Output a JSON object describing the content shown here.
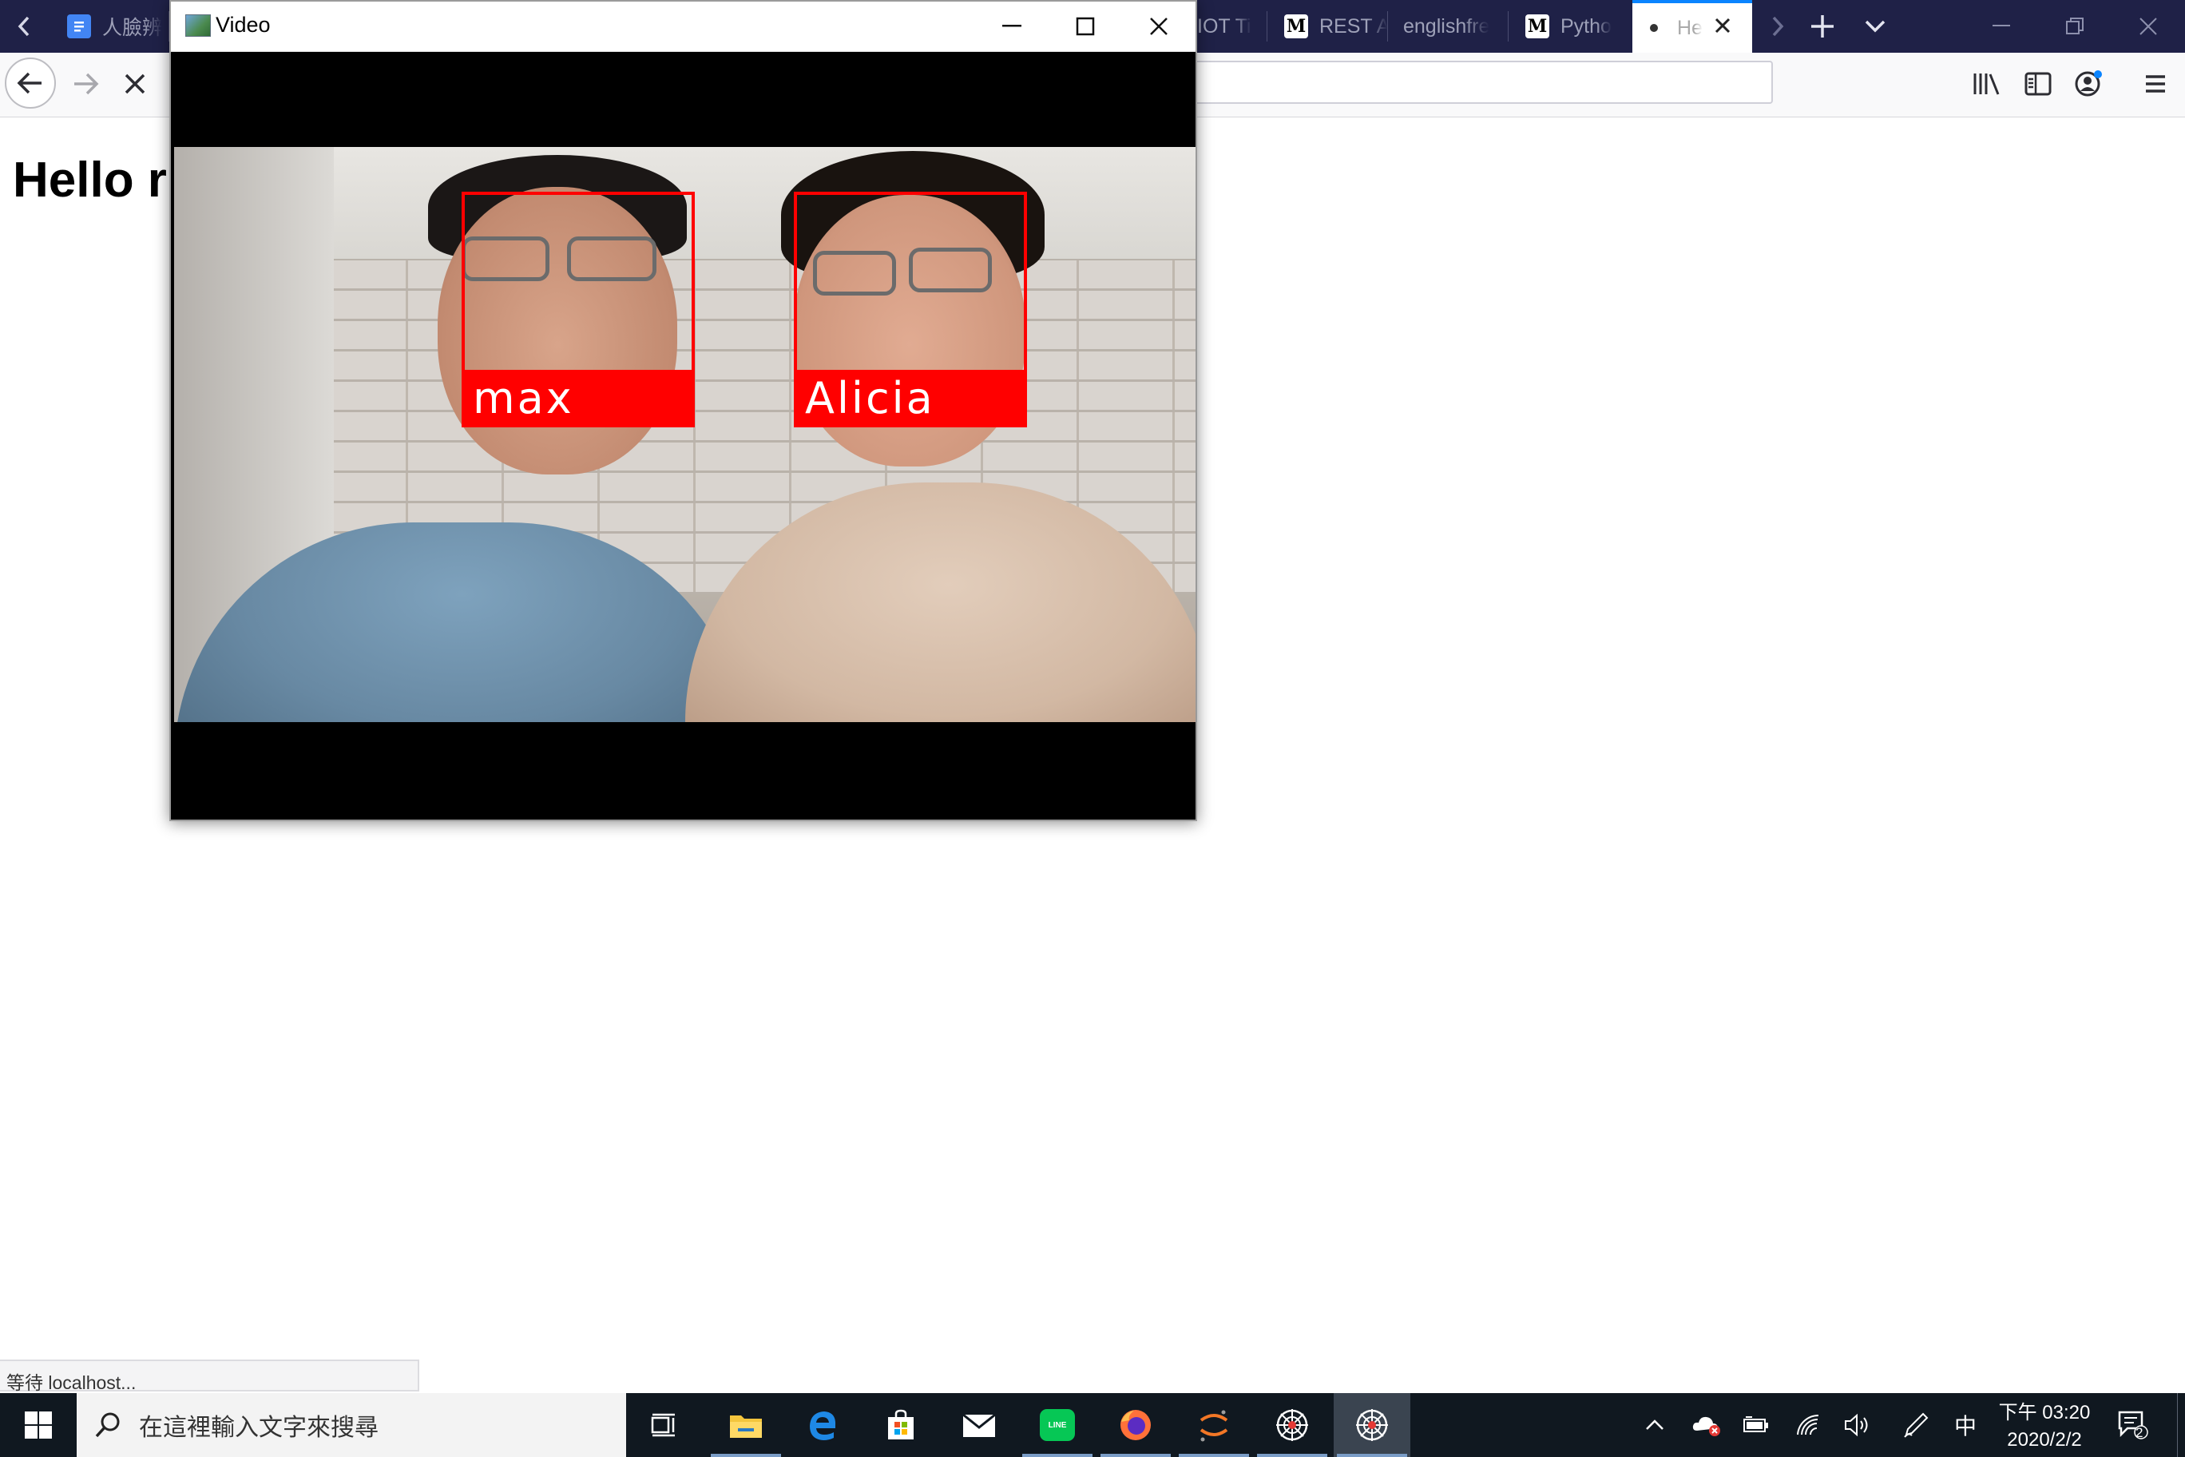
{
  "browser": {
    "tabs": [
      {
        "title": "人臉辨",
        "icon": "google-docs-icon"
      },
      {
        "title": "IOT Ti",
        "icon": ""
      },
      {
        "title": "REST A",
        "icon": "medium-icon"
      },
      {
        "title": "englishfre",
        "icon": ""
      },
      {
        "title": "Pytho",
        "icon": "medium-icon"
      },
      {
        "title": "He",
        "icon": "loading-dot-icon",
        "active": true
      }
    ],
    "medium_glyph": "M",
    "status_text": "等待 localhost...",
    "accent_color": "#0a84ff"
  },
  "page": {
    "heading": "Hello r"
  },
  "video_window": {
    "title": "Video",
    "detections": [
      {
        "name": "max",
        "color": "#ff0000"
      },
      {
        "name": "Alicia",
        "color": "#ff0000"
      }
    ]
  },
  "taskbar": {
    "search_placeholder": "在這裡輸入文字來搜尋",
    "apps": [
      "task-view-icon",
      "file-explorer-icon",
      "edge-icon",
      "store-icon",
      "mail-icon",
      "line-icon",
      "firefox-icon",
      "jupyter-icon",
      "chrome-like-icon",
      "chrome-like-icon"
    ],
    "line_label": "LINE",
    "ime": "中",
    "clock_time": "下午 03:20",
    "clock_date": "2020/2/2",
    "notification_count": "2"
  }
}
